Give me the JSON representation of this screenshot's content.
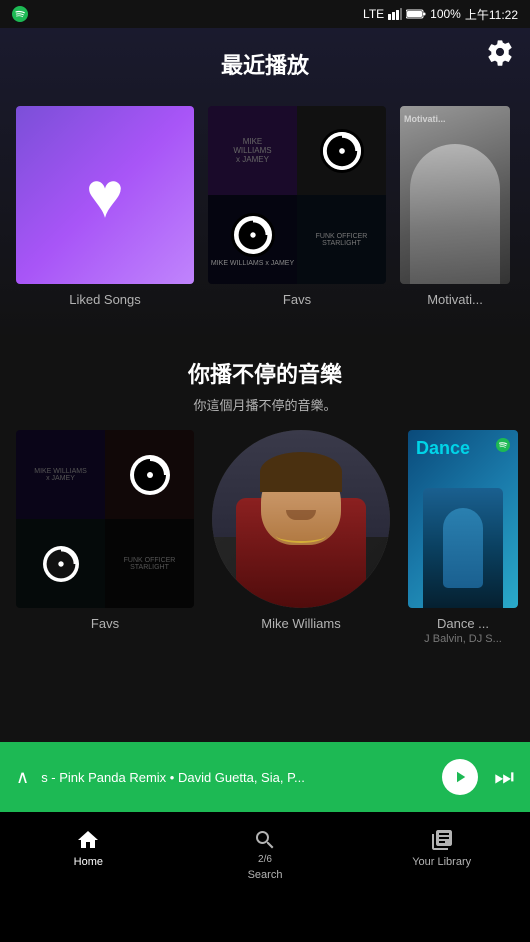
{
  "status": {
    "app_icon": "spotify",
    "signal": "LTE",
    "battery": "100%",
    "time": "上午11:22"
  },
  "header": {
    "section1_title": "最近播放",
    "section2_title": "你播不停的音樂",
    "section2_subtitle": "你這個月播不停的音樂。"
  },
  "recently_played": {
    "items": [
      {
        "id": "liked-songs",
        "label": "Liked Songs",
        "type": "liked"
      },
      {
        "id": "favs",
        "label": "Favs",
        "type": "collage"
      },
      {
        "id": "motivation",
        "label": "Motivati...",
        "type": "motivation"
      }
    ]
  },
  "continuous_music": {
    "items": [
      {
        "id": "favs2",
        "label": "Favs",
        "sublabel": "",
        "type": "collage"
      },
      {
        "id": "mike-williams",
        "label": "Mike Williams",
        "sublabel": "",
        "type": "portrait"
      },
      {
        "id": "dance",
        "label": "Dance ...",
        "sublabel": "J Balvin, DJ S...",
        "type": "dance"
      }
    ]
  },
  "now_playing": {
    "chevron": "∧",
    "track": "s - Pink Panda Remix • David Guetta, Sia, P...",
    "progress_label": "2/6"
  },
  "bottom_nav": {
    "items": [
      {
        "id": "home",
        "label": "Home",
        "icon": "home",
        "active": true
      },
      {
        "id": "search",
        "label": "Search",
        "icon": "search",
        "active": false
      },
      {
        "id": "library",
        "label": "Your Library",
        "icon": "library",
        "active": false
      }
    ]
  }
}
